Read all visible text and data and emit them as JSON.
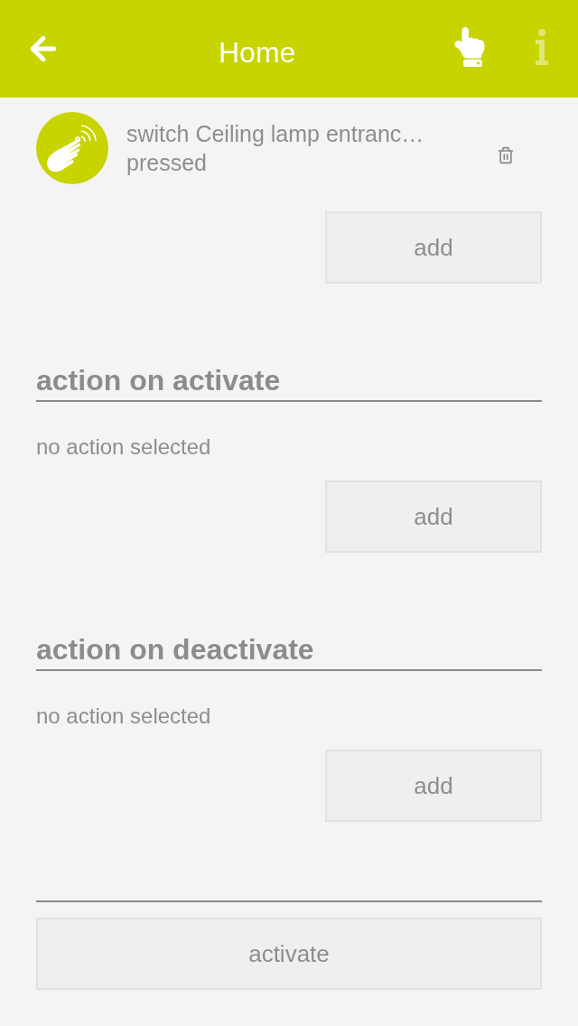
{
  "header": {
    "title": "Home",
    "info_button": {
      "disabled": true
    }
  },
  "triggers": [
    {
      "title": "switch Ceiling lamp entranc…",
      "event": "pressed"
    }
  ],
  "trigger_add": {
    "label": "add"
  },
  "sections": [
    {
      "heading": "action on activate",
      "status": "no action selected",
      "add_label": "add"
    },
    {
      "heading": "action on deactivate",
      "status": "no action selected",
      "add_label": "add"
    }
  ],
  "activate_button": {
    "label": "activate"
  }
}
